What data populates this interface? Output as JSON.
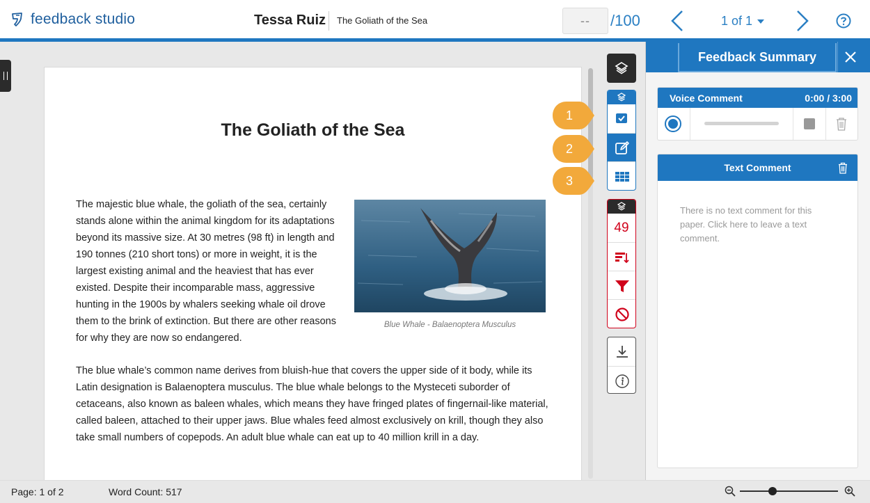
{
  "header": {
    "logo_text": "feedback studio",
    "student_name": "Tessa Ruiz",
    "paper_title": "The Goliath of the Sea",
    "grade_value": "--",
    "grade_total": "/100",
    "pagination": "1 of 1"
  },
  "paper": {
    "title": "The Goliath of the Sea",
    "paragraph1": "The majestic blue whale, the goliath of the sea, certainly stands alone within the animal kingdom for its adaptations beyond its massive size. At 30 metres (98 ft) in length and 190 tonnes (210 short tons) or more in weight, it is the largest existing animal and the heaviest that has ever existed. Despite their incomparable mass, aggressive hunting in the 1900s by whalers seeking whale oil drove them to the brink of extinction. But there are other reasons for why they are now so endangered.",
    "image_caption": "Blue Whale - Balaenoptera Musculus",
    "paragraph2": "The blue whale’s common name derives from bluish-hue that covers the upper side of it body, while its Latin designation is Balaenoptera musculus. The blue whale belongs to the Mysteceti suborder of cetaceans, also known as baleen whales, which means they have fringed plates of fingernail-like material, called baleen, attached to their upper jaws. Blue whales feed almost exclusively on krill, though they also take small numbers of copepods. An adult blue whale can eat up to 40 million krill in a day."
  },
  "toolbar": {
    "callouts": [
      "1",
      "2",
      "3"
    ],
    "similarity_count": "49"
  },
  "feedback_panel": {
    "title": "Feedback Summary",
    "voice_comment": {
      "label": "Voice Comment",
      "time": "0:00 / 3:00"
    },
    "text_comment": {
      "label": "Text Comment",
      "placeholder": "There is no text comment for this paper. Click here to leave a text comment."
    }
  },
  "footer": {
    "page": "Page: 1 of 2",
    "word_count": "Word Count: 517",
    "zoom_level": 0.33
  },
  "colors": {
    "accent": "#1f77c0",
    "similarity_red": "#d0021b",
    "callout_orange": "#f2a93b",
    "dark": "#2b2b2b"
  }
}
